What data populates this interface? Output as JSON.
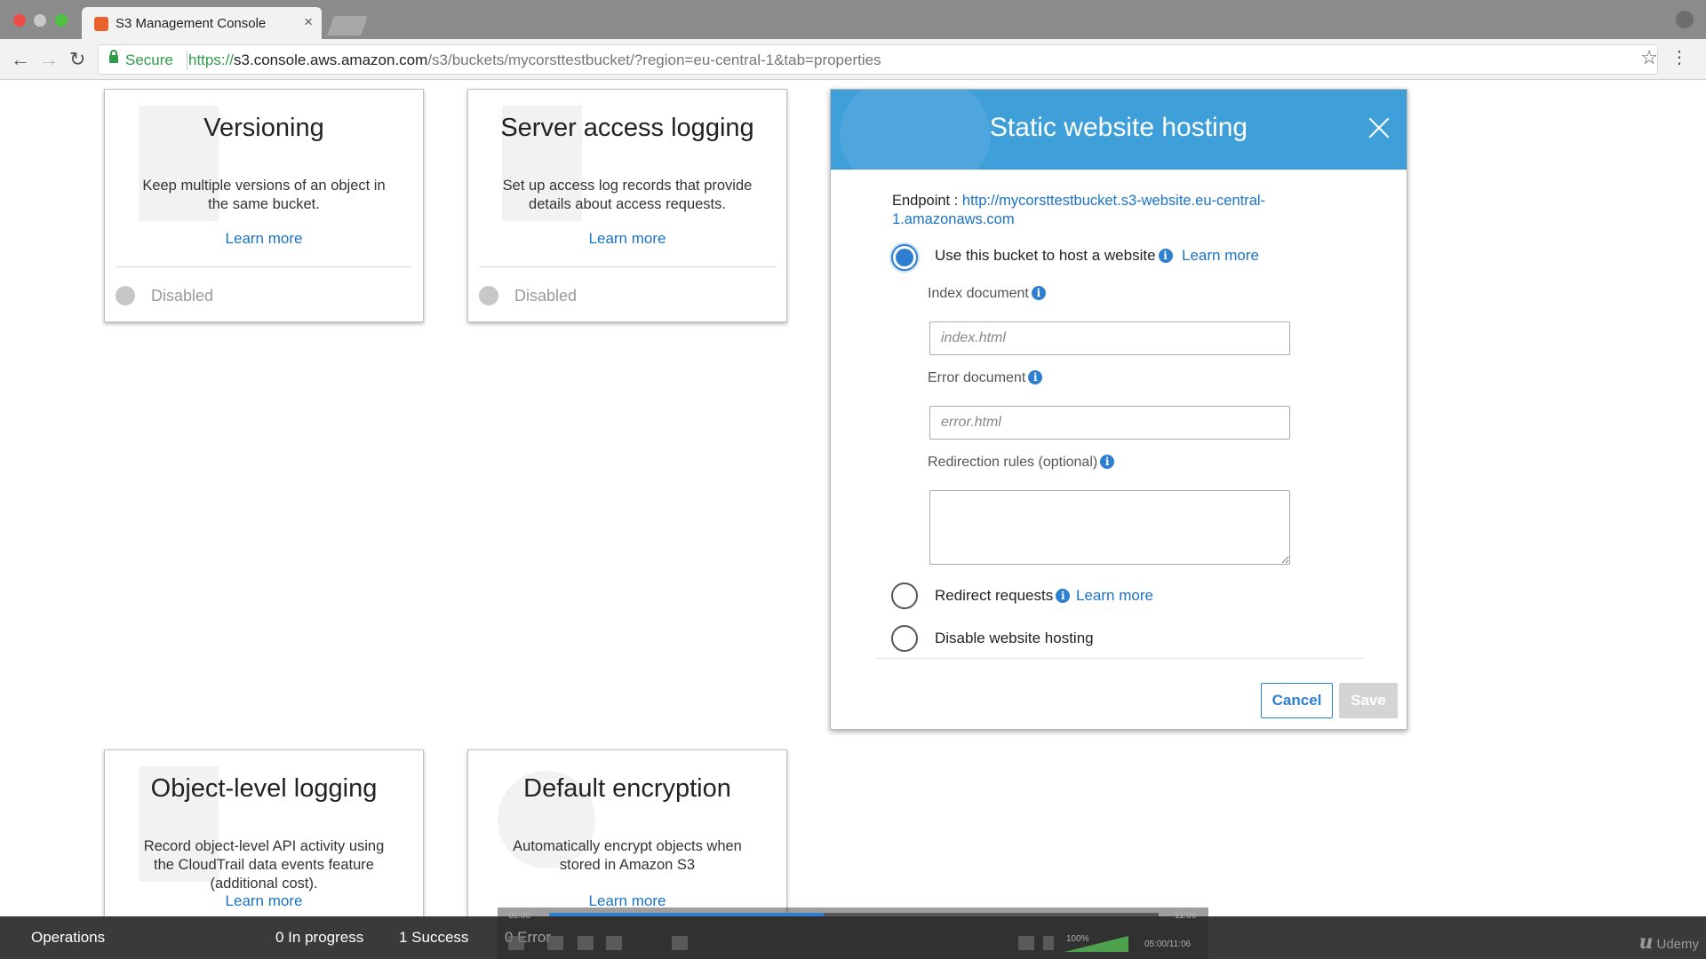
{
  "browser": {
    "tab_title": "S3 Management Console",
    "tab_close": "×",
    "secure_label": "Secure",
    "url_proto": "https://",
    "url_host": "s3.console.aws.amazon.com",
    "url_path": "/s3/buckets/mycorsttestbucket/?region=eu-central-1&tab=properties",
    "back_glyph": "←",
    "forward_glyph": "→",
    "reload_glyph": "↻",
    "star_glyph": "☆",
    "menu_glyph": "⋮"
  },
  "cards": {
    "versioning": {
      "title": "Versioning",
      "description": "Keep multiple versions of an object in the same bucket.",
      "link": "Learn more",
      "status": "Disabled"
    },
    "logging": {
      "title": "Server access logging",
      "description": "Set up access log records that provide details about access requests.",
      "link": "Learn more",
      "status": "Disabled"
    },
    "object_logging": {
      "title": "Object-level logging",
      "description": "Record object-level API activity using the CloudTrail data events feature (additional cost).",
      "link": "Learn more"
    },
    "encryption": {
      "title": "Default encryption",
      "description": "Automatically encrypt objects when stored in Amazon S3",
      "link": "Learn more"
    }
  },
  "modal": {
    "title": "Static website hosting",
    "endpoint_label": "Endpoint :",
    "endpoint_url": "http://mycorsttestbucket.s3-website.eu-central-1.amazonaws.com",
    "options": {
      "host": {
        "label": "Use this bucket to host a website",
        "link": "Learn more",
        "selected": true
      },
      "redirect": {
        "label": "Redirect requests",
        "link": "Learn more",
        "selected": false
      },
      "disable": {
        "label": "Disable website hosting",
        "selected": false
      }
    },
    "index_label": "Index document",
    "index_placeholder": "index.html",
    "error_label": "Error document",
    "error_placeholder": "error.html",
    "redirection_label": "Redirection rules (optional)",
    "info_glyph": "i",
    "cancel_label": "Cancel",
    "save_label": "Save"
  },
  "operations": {
    "label": "Operations",
    "in_progress": "0 In progress",
    "success": "1 Success",
    "error": "0 Error"
  },
  "video": {
    "time_start": "05:00",
    "time_end": "11:06",
    "time_current": "05:00/11:06",
    "volume_label": "100%",
    "progress_fraction": 0.45,
    "brand": "Udemy"
  },
  "colors": {
    "accent": "#2f7fd0",
    "modal_header": "#3f9fd9",
    "secure_green": "#2f9d48"
  }
}
